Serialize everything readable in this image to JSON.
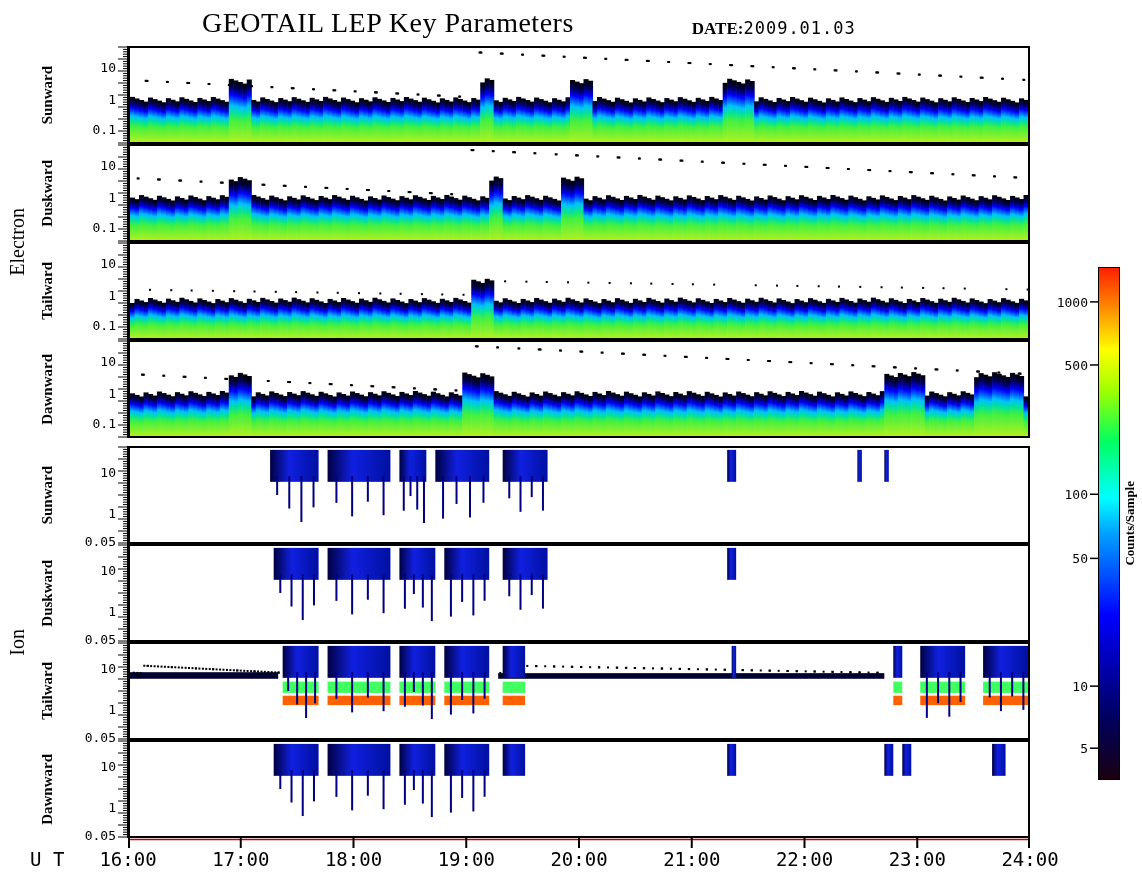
{
  "title": "GEOTAIL LEP Key Parameters",
  "date": {
    "label": "DATE:",
    "value": "2009.01.03"
  },
  "groups": [
    {
      "name": "Electron",
      "kind": "electron",
      "panels": [
        {
          "label": "Sunward",
          "y_ticks": [
            "10",
            "1",
            "0.1"
          ]
        },
        {
          "label": "Duskward",
          "y_ticks": [
            "10",
            "1",
            "0.1"
          ]
        },
        {
          "label": "Tailward",
          "y_ticks": [
            "10",
            "1",
            "0.1"
          ]
        },
        {
          "label": "Dawnward",
          "y_ticks": [
            "10",
            "1",
            "0.1"
          ]
        }
      ]
    },
    {
      "name": "Ion",
      "kind": "ion",
      "panels": [
        {
          "label": "Sunward",
          "y_ticks": [
            "10",
            "1",
            "0.05"
          ]
        },
        {
          "label": "Duskward",
          "y_ticks": [
            "10",
            "1",
            "0.05"
          ]
        },
        {
          "label": "Tailward",
          "y_ticks": [
            "10",
            "1",
            "0.05"
          ]
        },
        {
          "label": "Dawnward",
          "y_ticks": [
            "10",
            "1",
            "0.05"
          ]
        }
      ]
    }
  ],
  "colorbar": {
    "label": "Counts/Sample",
    "ticks": [
      "1000",
      "500",
      "100",
      "50",
      "10",
      "5"
    ]
  },
  "x_axis": {
    "label": "U T",
    "ticks": [
      "16:00",
      "17:00",
      "18:00",
      "19:00",
      "20:00",
      "21:00",
      "22:00",
      "23:00",
      "24:00"
    ]
  }
}
